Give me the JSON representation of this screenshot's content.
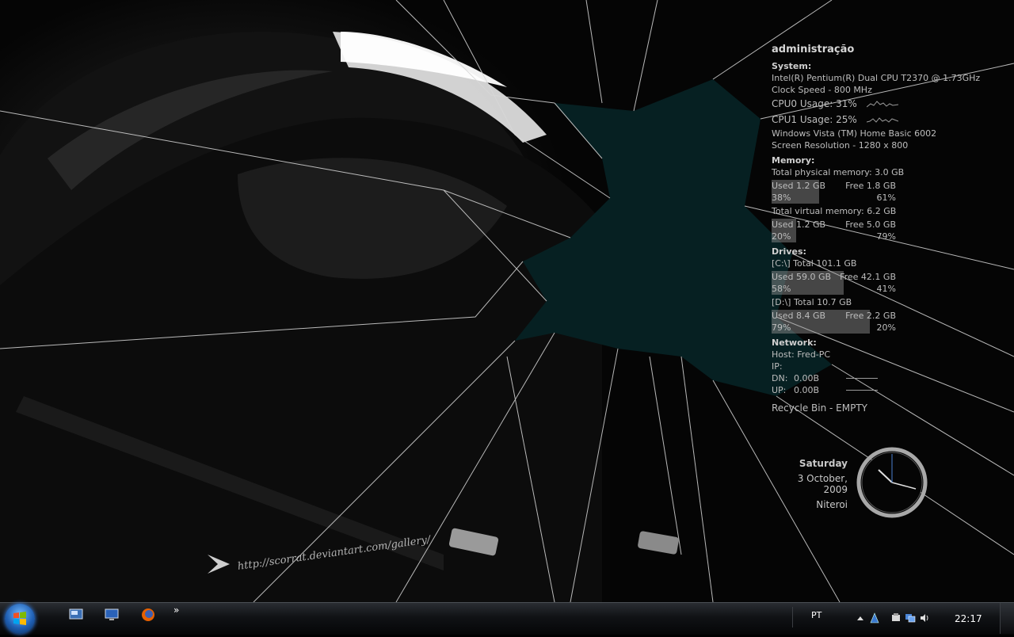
{
  "gadget": {
    "user": "administração",
    "system_heading": "System:",
    "cpu_model": "Intel(R) Pentium(R) Dual  CPU  T2370  @ 1.73GHz",
    "clock_speed": "Clock Speed - 800 MHz",
    "cpu0": "CPU0 Usage: 31%",
    "cpu1": "CPU1 Usage: 25%",
    "os": "Windows Vista (TM) Home Basic",
    "os_build": "6002",
    "resolution": "Screen Resolution - 1280 x 800",
    "memory_heading": "Memory:",
    "phys_total": "Total physical memory: 3.0 GB",
    "phys_used": "Used 1.2 GB",
    "phys_used_pct": "38%",
    "phys_free": "Free 1.8 GB",
    "phys_free_pct": "61%",
    "phys_used_fraction": 0.38,
    "virt_total": "Total virtual memory: 6.2 GB",
    "virt_used": "Used 1.2 GB",
    "virt_used_pct": "20%",
    "virt_free": "Free 5.0 GB",
    "virt_free_pct": "79%",
    "virt_used_fraction": 0.2,
    "drives_heading": "Drives:",
    "c_total": "[C:\\] Total 101.1 GB",
    "c_used": "Used 59.0 GB",
    "c_used_pct": "58%",
    "c_free": "Free 42.1 GB",
    "c_free_pct": "41%",
    "c_used_fraction": 0.58,
    "d_total": "[D:\\] Total 10.7 GB",
    "d_used": "Used 8.4 GB",
    "d_used_pct": "79%",
    "d_free": "Free 2.2 GB",
    "d_free_pct": "20%",
    "d_used_fraction": 0.79,
    "network_heading": "Network:",
    "host": "Host: Fred-PC",
    "ip": "IP:",
    "dn_label": "DN:",
    "dn_value": "0.00B",
    "up_label": "UP:",
    "up_value": "0.00B",
    "recycle": "Recycle Bin - EMPTY"
  },
  "clock": {
    "day": "Saturday",
    "date": "3 October, 2009",
    "city": "Niteroi"
  },
  "watermark": "http://scorrat.deviantart.com/gallery/",
  "taskbar": {
    "language": "PT",
    "time": "22:17",
    "more": "»"
  },
  "colors": {
    "crack_hole": "#062022",
    "taskbar": "#101215",
    "text": "#bdbdbd"
  }
}
